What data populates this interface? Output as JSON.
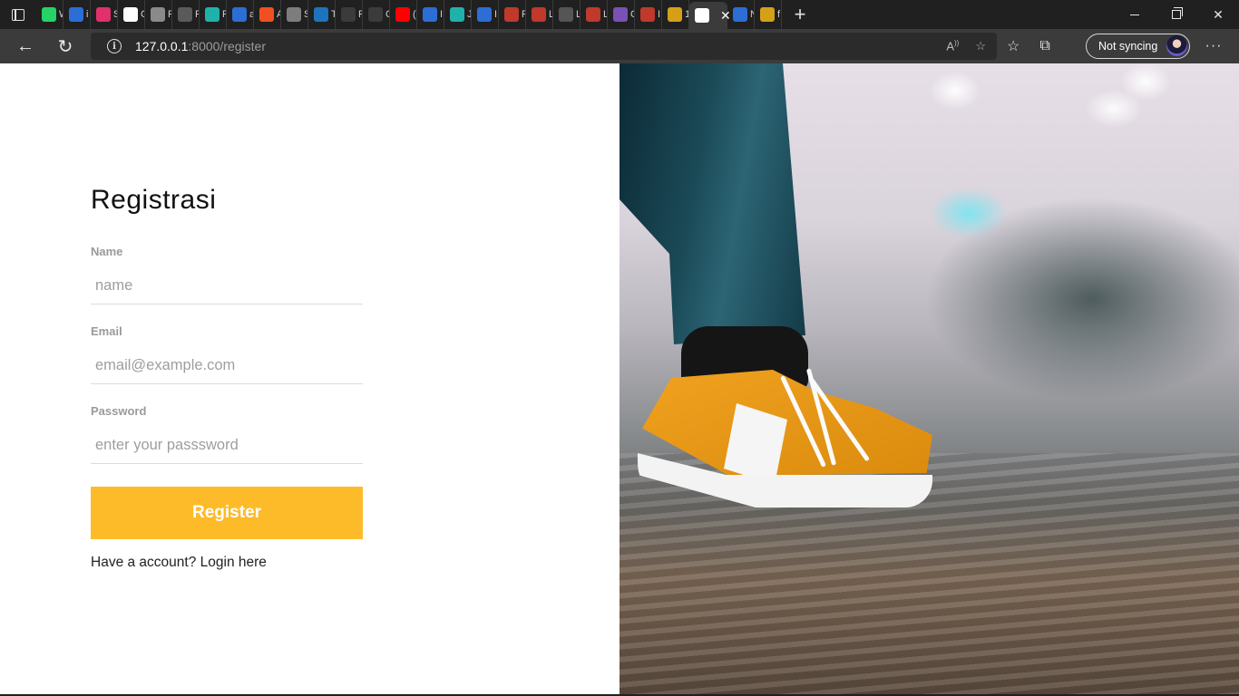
{
  "browser": {
    "tabs": [
      {
        "label": "W",
        "favicon_color": "#25d366",
        "icon": "whatsapp-icon"
      },
      {
        "label": "i",
        "favicon_color": "#2c6ed5",
        "icon": "search-icon"
      },
      {
        "label": "S",
        "favicon_color": "#e1306c",
        "icon": "instagram-icon"
      },
      {
        "label": "C",
        "favicon_color": "#ffffff",
        "icon": "app-icon"
      },
      {
        "label": "F",
        "favicon_color": "#8a8a8a",
        "icon": "elephant-icon"
      },
      {
        "label": "F",
        "favicon_color": "#5a5a5a",
        "icon": "globe-icon"
      },
      {
        "label": "F",
        "favicon_color": "#20b2aa",
        "icon": "app-icon"
      },
      {
        "label": "a",
        "favicon_color": "#2c6ed5",
        "icon": "bing-icon"
      },
      {
        "label": "A",
        "favicon_color": "#f25022",
        "icon": "microsoft-icon"
      },
      {
        "label": "S",
        "favicon_color": "#7d7d7d",
        "icon": "app-icon"
      },
      {
        "label": "T",
        "favicon_color": "#1e73be",
        "icon": "app-icon"
      },
      {
        "label": "F",
        "favicon_color": "#3b3b3b",
        "icon": "speaker-icon"
      },
      {
        "label": "C",
        "favicon_color": "#3b3b3b",
        "icon": "document-icon"
      },
      {
        "label": "(",
        "favicon_color": "#ff0000",
        "icon": "youtube-icon"
      },
      {
        "label": "I",
        "favicon_color": "#2c6ed5",
        "icon": "search-icon"
      },
      {
        "label": "J",
        "favicon_color": "#20b2aa",
        "icon": "app-icon"
      },
      {
        "label": "I",
        "favicon_color": "#2c6ed5",
        "icon": "search-icon"
      },
      {
        "label": "F",
        "favicon_color": "#c0392b",
        "icon": "app-icon"
      },
      {
        "label": "L",
        "favicon_color": "#c0392b",
        "icon": "app-icon"
      },
      {
        "label": "L",
        "favicon_color": "#555555",
        "icon": "app-icon"
      },
      {
        "label": "L",
        "favicon_color": "#c0392b",
        "icon": "app-icon"
      },
      {
        "label": "C",
        "favicon_color": "#7952b3",
        "icon": "bootstrap-icon"
      },
      {
        "label": "I",
        "favicon_color": "#c0392b",
        "icon": "laravel-icon"
      },
      {
        "label": "1",
        "favicon_color": "#d4a017",
        "icon": "app-icon"
      },
      {
        "label": "L",
        "favicon_color": "#ffffff",
        "icon": "app-icon",
        "active": true
      },
      {
        "label": "N",
        "favicon_color": "#2c6ed5",
        "icon": "search-icon"
      },
      {
        "label": "f",
        "favicon_color": "#d4a017",
        "icon": "app-icon"
      }
    ],
    "url_host": "127.0.0.1",
    "url_path": ":8000/register",
    "profile_label": "Not syncing"
  },
  "page": {
    "title": "Registrasi",
    "name_label": "Name",
    "name_placeholder": "name",
    "email_label": "Email",
    "email_placeholder": "email@example.com",
    "password_label": "Password",
    "password_placeholder": "enter your passsword",
    "register_button": "Register",
    "login_prompt": "Have a account?",
    "login_link": "Login here",
    "accent_color": "#fdbb2a"
  }
}
